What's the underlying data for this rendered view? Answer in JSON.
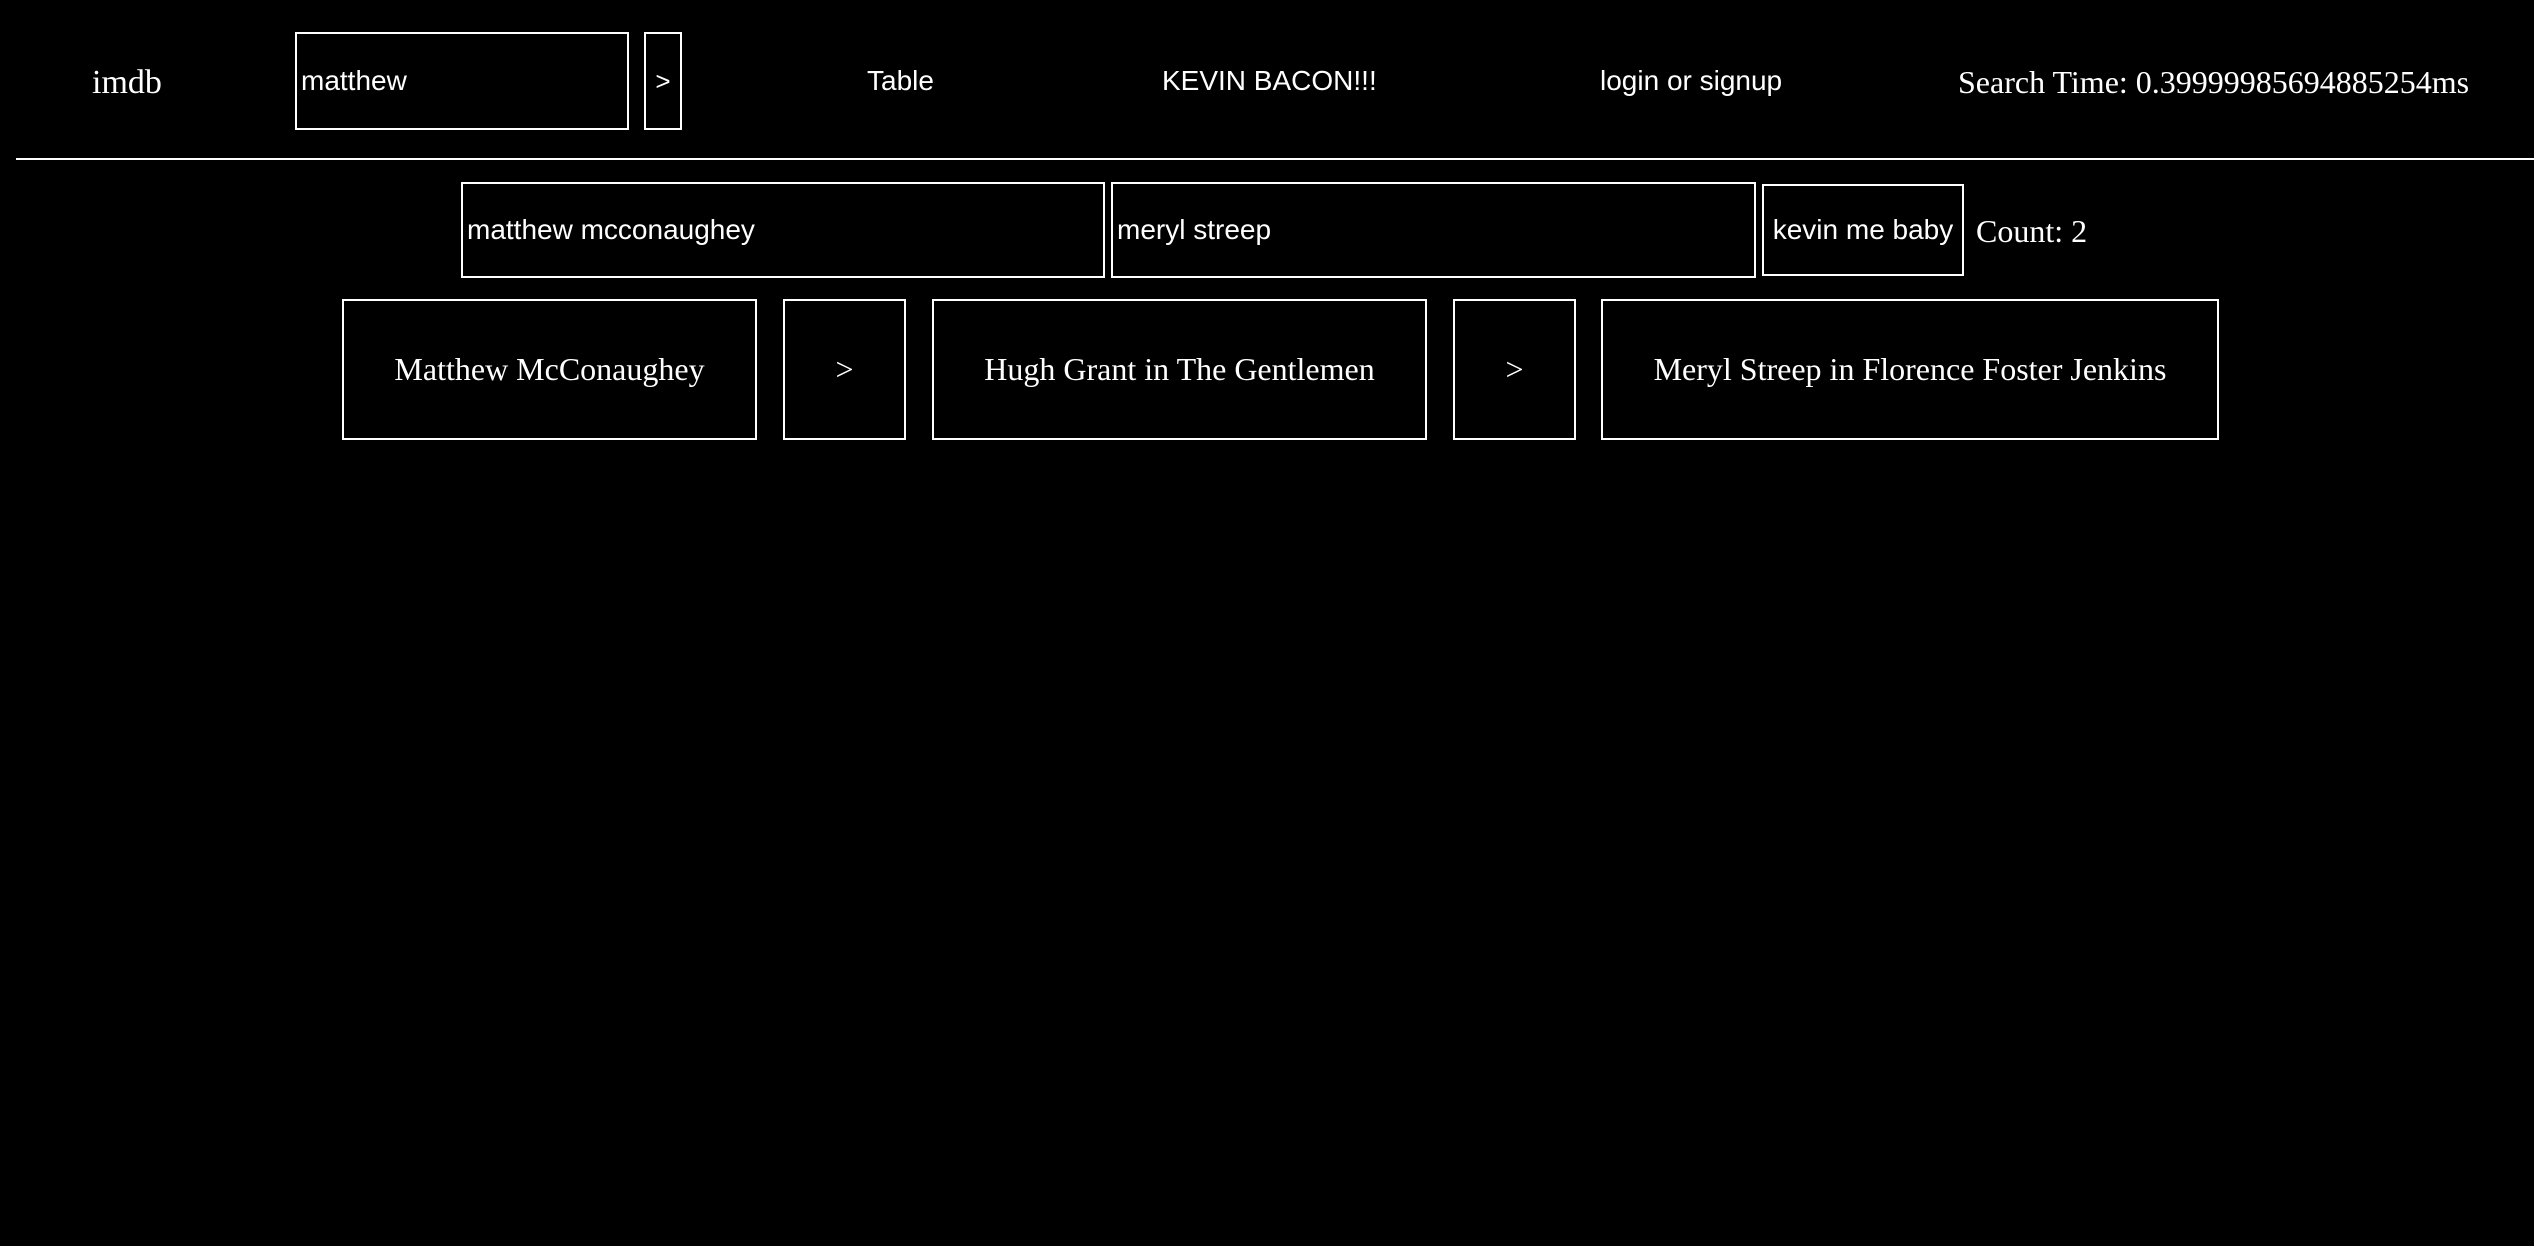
{
  "header": {
    "logo": "imdb",
    "search_value": "matthew",
    "search_go_label": ">",
    "nav": {
      "table": "Table",
      "kevin_bacon": "KEVIN BACON!!!",
      "login": "login or signup"
    },
    "search_time": "Search Time: 0.39999985694885254ms"
  },
  "path_search": {
    "from_value": "matthew mcconaughey",
    "to_value": "meryl streep",
    "button_label": "kevin me baby",
    "count": "Count: 2"
  },
  "chain": {
    "nodes": [
      "Matthew McConaughey",
      "Hugh Grant in The Gentlemen",
      "Meryl Streep in Florence Foster Jenkins"
    ],
    "separators": [
      ">",
      ">"
    ]
  },
  "colors": {
    "background": "#000000",
    "foreground": "#ffffff"
  }
}
